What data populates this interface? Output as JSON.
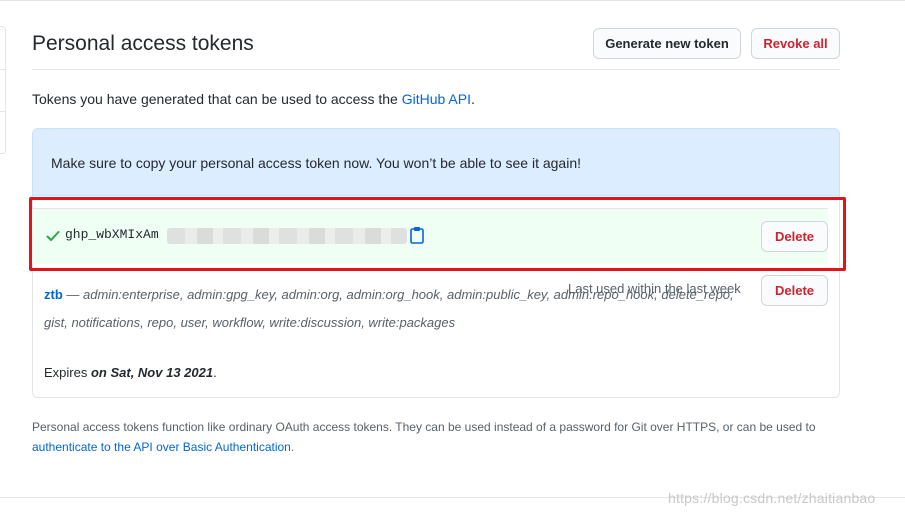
{
  "header": {
    "title": "Personal access tokens",
    "generate_label": "Generate new token",
    "revoke_label": "Revoke all"
  },
  "intro": {
    "text_before": "Tokens you have generated that can be used to access the ",
    "link": "GitHub API",
    "text_after": "."
  },
  "flash": {
    "message": "Make sure to copy your personal access token now. You won’t be able to see it again!"
  },
  "new_token": {
    "value_prefix": "ghp_wbXMIxAm",
    "delete_label": "Delete"
  },
  "tokens": [
    {
      "name": "ztb",
      "dash": " — ",
      "scopes": "admin:enterprise, admin:gpg_key, admin:org, admin:org_hook, admin:public_key, admin:repo_hook, delete_repo, gist, notifications, repo, user, workflow, write:discussion, write:packages",
      "last_used": "Last used within the last week",
      "expires_prefix": "Expires ",
      "expires_date": "on Sat, Nov 13 2021",
      "expires_suffix": ".",
      "delete_label": "Delete"
    }
  ],
  "footer": {
    "text_before": "Personal access tokens function like ordinary OAuth access tokens. They can be used instead of a password for Git over HTTPS, or can be used to ",
    "link": "authenticate to the API over Basic Authentication",
    "text_after": "."
  },
  "watermark": "https://blog.csdn.net/zhaitianbao",
  "colors": {
    "link": "#0366d6",
    "danger": "#cb2431",
    "flash_bg": "#dbedff",
    "success_bg": "#f0fff4",
    "highlight": "#e4121b"
  },
  "icons": [
    "check-icon",
    "clipboard-icon"
  ]
}
